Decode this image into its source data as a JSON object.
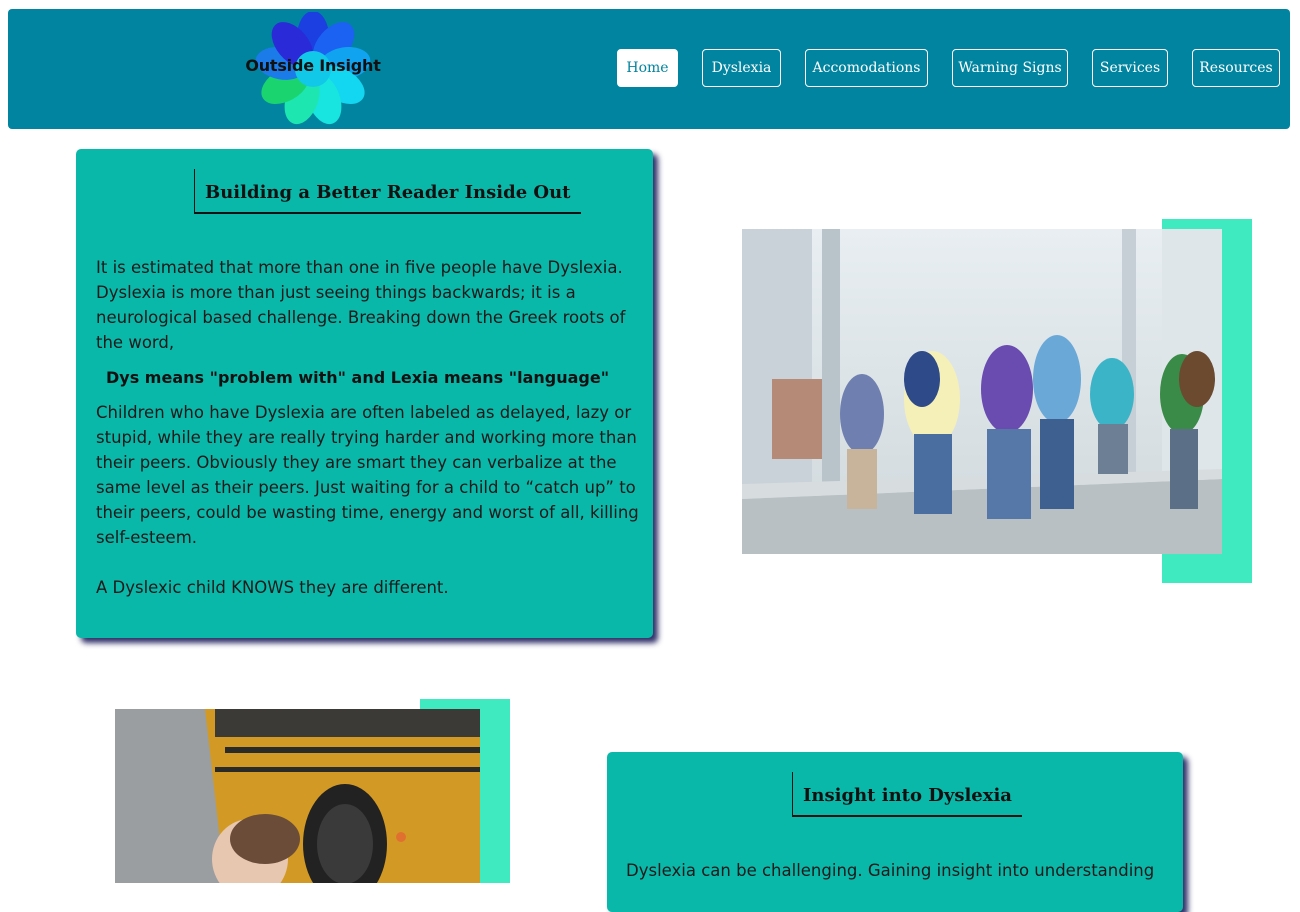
{
  "header": {
    "logo_text": "Outside Insight",
    "nav": [
      {
        "label": "Home",
        "active": true
      },
      {
        "label": "Dyslexia",
        "active": false
      },
      {
        "label": "Accomodations",
        "active": false
      },
      {
        "label": "Warning Signs",
        "active": false
      },
      {
        "label": "Services",
        "active": false
      },
      {
        "label": "Resources",
        "active": false
      }
    ]
  },
  "section1": {
    "title": "Building a Better Reader Inside Out",
    "paragraph1": "It is estimated that more than one in five people have Dyslexia. Dyslexia is more than just seeing things backwards; it is a neurological based challenge. Breaking down the Greek roots of the word,",
    "emphasis": "Dys means \"problem with\" and Lexia means \"language\"",
    "paragraph2": "Children who have Dyslexia are often labeled as delayed, lazy or stupid, while they are really trying harder and working more than their peers. Obviously they are smart they can verbalize at the same level as their peers. Just waiting for a child to “catch up” to their peers, could be wasting time, energy and worst of all, killing self-esteem.",
    "paragraph3": "A Dyslexic child KNOWS they are different."
  },
  "section2": {
    "title": "Insight into Dyslexia",
    "paragraph1": "Dyslexia can be challenging. Gaining insight into understanding"
  },
  "colors": {
    "header_bg": "#00849f",
    "card_bg": "#0ab8aa",
    "accent": "#40eac1",
    "shadow": "#31316b"
  }
}
